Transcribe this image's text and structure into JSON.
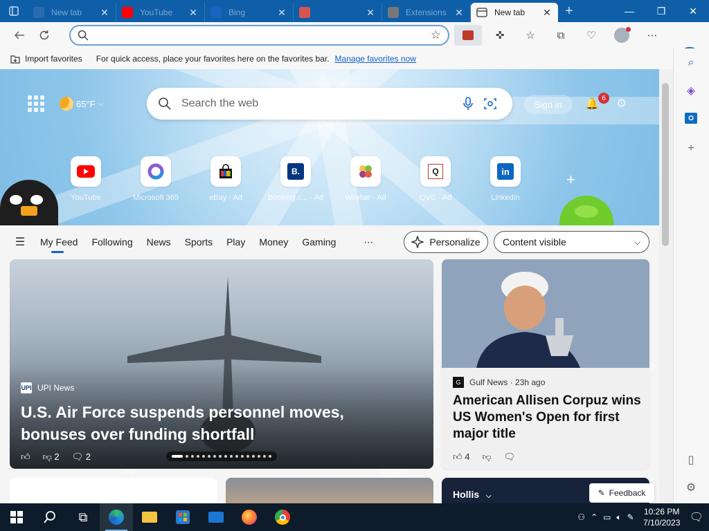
{
  "tabs": [
    {
      "label": "New tab",
      "favicon_color": "#2b6cb0",
      "active": false
    },
    {
      "label": "YouTube",
      "favicon_color": "#ff0000",
      "active": false
    },
    {
      "label": "Bing",
      "favicon_color": "#1565c0",
      "active": false
    },
    {
      "label": "",
      "favicon_color": "#d9534f",
      "active": false
    },
    {
      "label": "Extensions",
      "favicon_color": "#777777",
      "active": false
    },
    {
      "label": "New tab",
      "favicon_color": "#2b6cb0",
      "active": true
    }
  ],
  "favorites_bar": {
    "import_label": "Import favorites",
    "message": "For quick access, place your favorites here on the favorites bar.",
    "manage_link": "Manage favorites now"
  },
  "weather": {
    "temp": "65°F"
  },
  "search": {
    "placeholder": "Search the web"
  },
  "header": {
    "signin": "Sign in",
    "notification_count": "6"
  },
  "quick_links": [
    {
      "name": "YouTube"
    },
    {
      "name": "Microsoft 365"
    },
    {
      "name": "eBay · Ad"
    },
    {
      "name": "Booking.c... · Ad"
    },
    {
      "name": "Wayfair · Ad"
    },
    {
      "name": "QVC · Ad"
    },
    {
      "name": "LinkedIn"
    }
  ],
  "feed_nav": {
    "items": [
      "My Feed",
      "Following",
      "News",
      "Sports",
      "Play",
      "Money",
      "Gaming"
    ],
    "personalize": "Personalize",
    "content_visibility": "Content visible"
  },
  "main_article": {
    "source": "UPI News",
    "title": "U.S. Air Force suspends personnel moves, bonuses over funding shortfall",
    "dislikes": "2",
    "comments": "2"
  },
  "side_article": {
    "source": "Gulf News · 23h ago",
    "title": "American Allisen Corpuz wins US Women's Open for first major title",
    "likes": "4"
  },
  "bottom_cards": {
    "weather_location": "Hollis"
  },
  "feedback": "Feedback",
  "taskbar": {
    "time": "10:26 PM",
    "date": "7/10/2023"
  }
}
